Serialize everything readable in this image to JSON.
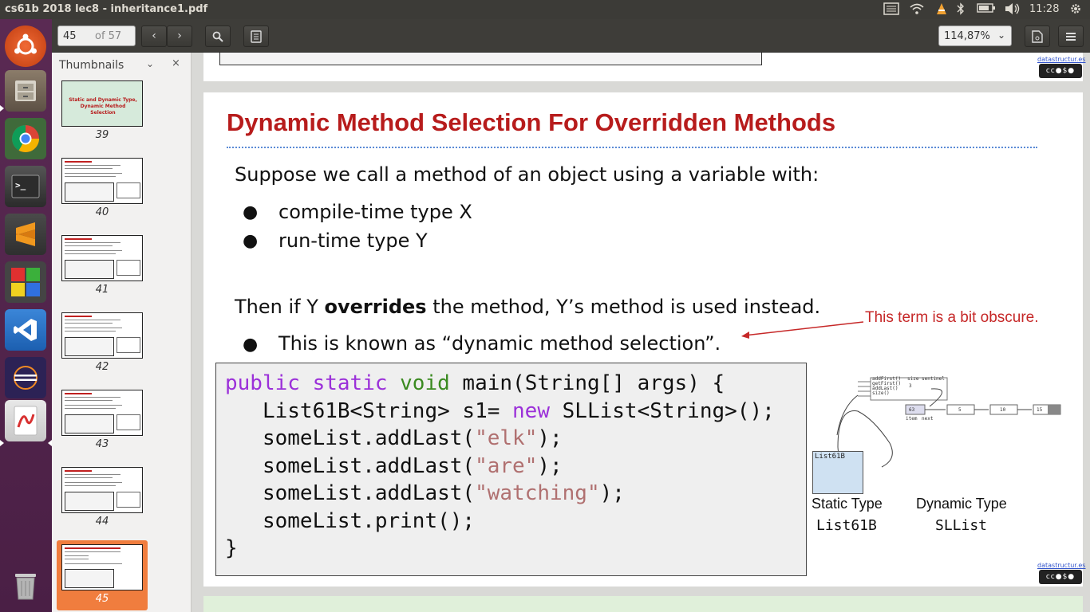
{
  "window": {
    "title": "cs61b 2018 lec8 - inheritance1.pdf"
  },
  "tray": {
    "keyboard_icon": "keyboard-icon",
    "wifi_icon": "wifi-icon",
    "bluetooth_icon": "bluetooth-icon",
    "battery_icon": "battery-icon",
    "volume_icon": "volume-icon",
    "clock": "11:28",
    "settings_icon": "gear-icon"
  },
  "launcher": {
    "items": [
      {
        "name": "ubuntu-dash",
        "icon": "ubuntu-logo-icon",
        "color": "#e05420"
      },
      {
        "name": "files",
        "icon": "file-cabinet-icon",
        "color": "#7a6a58"
      },
      {
        "name": "chrome",
        "icon": "chrome-icon",
        "color": "#3f8a3a"
      },
      {
        "name": "terminal",
        "icon": "terminal-icon",
        "color": "#2d2d2d"
      },
      {
        "name": "sublime-text",
        "icon": "sublime-icon",
        "color": "#f0981e"
      },
      {
        "name": "colorful-app",
        "icon": "squares-icon",
        "color": "#c03030"
      },
      {
        "name": "vscode",
        "icon": "vscode-icon",
        "color": "#2b7bd8"
      },
      {
        "name": "eclipse",
        "icon": "eclipse-icon",
        "color": "#2c2255"
      },
      {
        "name": "document-viewer",
        "icon": "pdf-viewer-icon",
        "color": "#d84040"
      },
      {
        "name": "trash",
        "icon": "trash-icon",
        "color": "#888888"
      }
    ]
  },
  "toolbar": {
    "page_current": "45",
    "page_total": "of 57",
    "prev_icon": "chevron-left-icon",
    "next_icon": "chevron-right-icon",
    "search_icon": "search-icon",
    "annotate_icon": "annotate-icon",
    "zoom": "114,87%",
    "save_icon": "document-icon",
    "menu_icon": "hamburger-menu-icon"
  },
  "sidebar": {
    "title": "Thumbnails",
    "thumbnails": [
      {
        "page": "39",
        "text": "Static and Dynamic Type, Dynamic Method Selection"
      },
      {
        "page": "40"
      },
      {
        "page": "41"
      },
      {
        "page": "42"
      },
      {
        "page": "43"
      },
      {
        "page": "44"
      },
      {
        "page": "45",
        "selected": true
      }
    ]
  },
  "slide": {
    "title": "Dynamic Method Selection For Overridden Methods",
    "intro": "Suppose we call a method of an object using a variable with:",
    "bullets": [
      "compile-time type X",
      "run-time type Y"
    ],
    "then_prefix": "Then if Y ",
    "then_bold": "overrides",
    "then_suffix": " the method, Y’s method is used instead.",
    "known_as": "This is known as “dynamic method selection”.",
    "annotation": "This term is a bit obscure.",
    "code": {
      "line1_public": "public",
      "line1_static": "static",
      "line1_void": "void",
      "line1_rest": " main(String[] args) {",
      "line2_a": "   List61B<String> s1= ",
      "line2_new": "new",
      "line2_b": " SLList<String>();",
      "line3_a": "   someList.addLast(",
      "line3_str": "\"elk\"",
      "line3_b": ");",
      "line4_a": "   someList.addLast(",
      "line4_str": "\"are\"",
      "line4_b": ");",
      "line5_a": "   someList.addLast(",
      "line5_str": "\"watching\"",
      "line5_b": ");",
      "line6": "   someList.print();",
      "line7": "}"
    },
    "diagram": {
      "methods": [
        "addFirst()",
        "getFirst()",
        "addLast()",
        "size()"
      ],
      "size_label": "size",
      "sentinel_label": "sentinel",
      "size_value": "3",
      "nodes": [
        "63",
        "5",
        "10",
        "15"
      ],
      "item_label": "item",
      "next_label": "next",
      "static_box_label": "List61B",
      "static_type_label": "Static Type",
      "static_type_value": "List61B",
      "dynamic_type_label": "Dynamic Type",
      "dynamic_type_value": "SLList"
    },
    "footer_link": "datastructur.es",
    "license_badge": "cc-by-nc-sa-icon"
  }
}
